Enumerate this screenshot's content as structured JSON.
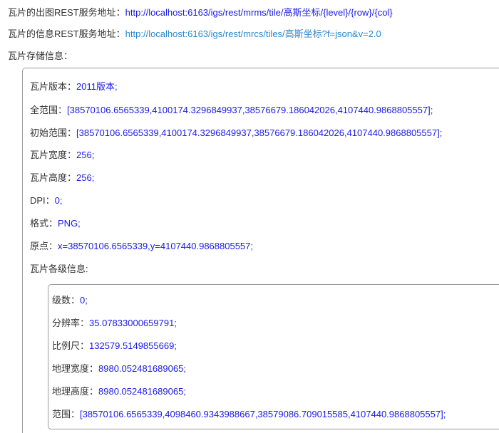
{
  "rest": {
    "map_url_label": "瓦片的出图REST服务地址：",
    "map_url": "http://localhost:6163/igs/rest/mrms/tile/高斯坐标/{level}/{row}/{col}",
    "info_url_label": "瓦片的信息REST服务地址：",
    "info_url": "http://localhost:6163/igs/rest/mrcs/tiles/高斯坐标?f=json&v=2.0"
  },
  "storage": {
    "title": "瓦片存储信息：",
    "version_label": "瓦片版本：",
    "version_value": "2011版本;",
    "full_extent_label": "全范围：",
    "full_extent_value": "[38570106.6565339,4100174.3296849937,38576679.186042026,4107440.9868805557];",
    "init_extent_label": "初始范围：",
    "init_extent_value": "[38570106.6565339,4100174.3296849937,38576679.186042026,4107440.9868805557];",
    "tile_width_label": "瓦片宽度：",
    "tile_width_value": "256;",
    "tile_height_label": "瓦片高度：",
    "tile_height_value": "256;",
    "dpi_label": "DPI：",
    "dpi_value": "0;",
    "format_label": "格式：",
    "format_value": "PNG;",
    "origin_label": "原点：",
    "origin_value": "x=38570106.6565339,y=4107440.9868805557;",
    "levels_title": "瓦片各级信息:"
  },
  "level": {
    "level_label": "级数：",
    "level_value": "0;",
    "resolution_label": "分辨率：",
    "resolution_value": "35.07833000659791;",
    "scale_label": "比例尺：",
    "scale_value": "132579.5149855669;",
    "geo_width_label": "地理宽度：",
    "geo_width_value": "8980.052481689065;",
    "geo_height_label": "地理高度：",
    "geo_height_value": "8980.052481689065;",
    "extent_label": "范围：",
    "extent_value": "[38570106.6565339,4098460.9343988667,38579086.709015585,4107440.9868805557];"
  }
}
